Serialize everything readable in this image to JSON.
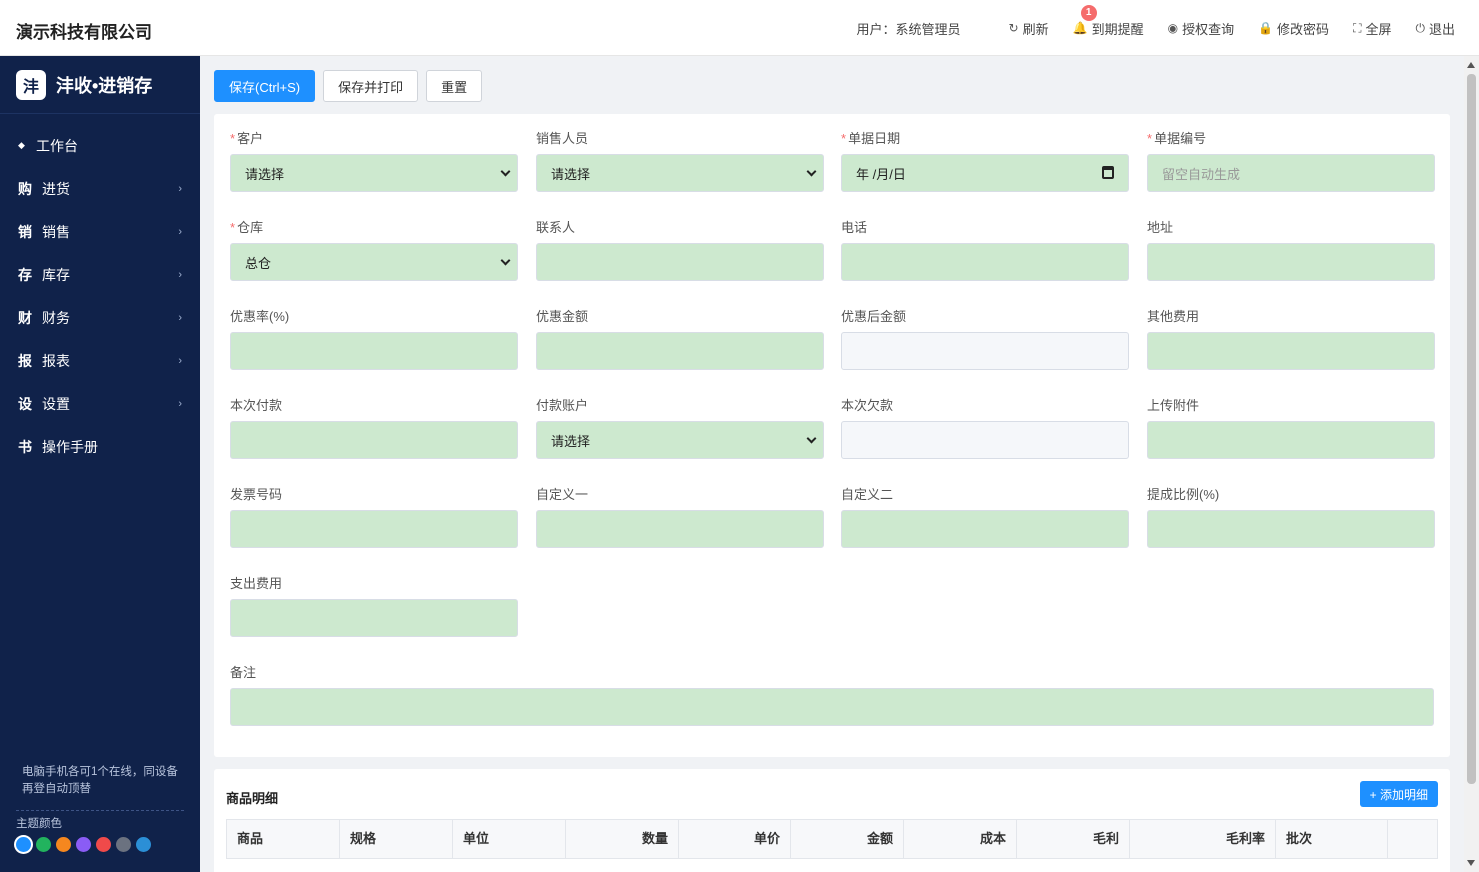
{
  "header": {
    "company": "演示科技有限公司",
    "user_label": "用户：系统管理员",
    "actions": [
      {
        "name": "refresh",
        "icon": "↻",
        "label": "刷新"
      },
      {
        "name": "reminder",
        "icon": "🔔",
        "label": "到期提醒",
        "badge": "1"
      },
      {
        "name": "license",
        "icon": "◉",
        "label": "授权查询"
      },
      {
        "name": "password",
        "icon": "🔒",
        "label": "修改密码"
      },
      {
        "name": "fullscreen",
        "icon": "⛶",
        "label": "全屏"
      },
      {
        "name": "logout",
        "icon": "⏻",
        "label": "退出"
      }
    ]
  },
  "sidebar": {
    "logo_char": "沣",
    "brand": "沣收•进销存",
    "items": [
      {
        "icon": "◆",
        "label": "工作台",
        "arrow": false
      },
      {
        "icon": "购",
        "label": "进货",
        "arrow": true
      },
      {
        "icon": "销",
        "label": "销售",
        "arrow": true
      },
      {
        "icon": "存",
        "label": "库存",
        "arrow": true
      },
      {
        "icon": "财",
        "label": "财务",
        "arrow": true
      },
      {
        "icon": "报",
        "label": "报表",
        "arrow": true
      },
      {
        "icon": "设",
        "label": "设置",
        "arrow": true
      },
      {
        "icon": "书",
        "label": "操作手册",
        "arrow": false
      }
    ],
    "tip_line1": "电脑手机各可1个在线，同设备",
    "tip_line2": "再登自动顶替",
    "theme_label": "主题颜色",
    "theme_colors": [
      "#1e90ff",
      "#22b35e",
      "#f5871f",
      "#8a5cf5",
      "#f04a4a",
      "#6b7280",
      "#2b8fd6"
    ]
  },
  "toolbar": {
    "save": "保存(Ctrl+S)",
    "save_print": "保存并打印",
    "reset": "重置"
  },
  "form": {
    "customer": {
      "label": "客户",
      "value": "请选择"
    },
    "salesperson": {
      "label": "销售人员",
      "value": "请选择"
    },
    "doc_date": {
      "label": "单据日期",
      "value": "年 /月/日"
    },
    "doc_no": {
      "label": "单据编号",
      "placeholder": "留空自动生成"
    },
    "warehouse": {
      "label": "仓库",
      "value": "总仓"
    },
    "contact": {
      "label": "联系人"
    },
    "phone": {
      "label": "电话"
    },
    "address": {
      "label": "地址"
    },
    "discount_rate": {
      "label": "优惠率(%)"
    },
    "discount_amount": {
      "label": "优惠金额"
    },
    "after_discount": {
      "label": "优惠后金额"
    },
    "other_fees": {
      "label": "其他费用"
    },
    "payment": {
      "label": "本次付款"
    },
    "pay_account": {
      "label": "付款账户",
      "value": "请选择"
    },
    "debt": {
      "label": "本次欠款"
    },
    "attachment": {
      "label": "上传附件"
    },
    "invoice_no": {
      "label": "发票号码"
    },
    "custom1": {
      "label": "自定义一"
    },
    "custom2": {
      "label": "自定义二"
    },
    "commission": {
      "label": "提成比例(%)"
    },
    "expense": {
      "label": "支出费用"
    },
    "remark": {
      "label": "备注"
    }
  },
  "detail": {
    "title": "商品明细",
    "add_button": "+ 添加明细",
    "columns": [
      "商品",
      "规格",
      "单位",
      "数量",
      "单价",
      "金额",
      "成本",
      "毛利",
      "毛利率",
      "批次",
      ""
    ]
  }
}
